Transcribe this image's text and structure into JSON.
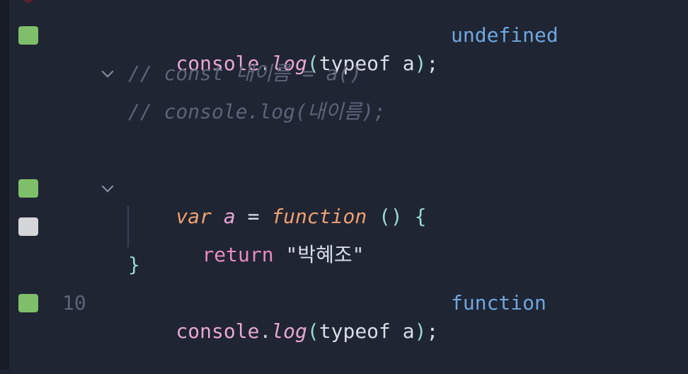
{
  "lines": [
    {
      "code": {
        "obj": "console",
        "dot": ".",
        "fn": "log",
        "open": "(",
        "arg": "typeof a",
        "close": ")",
        "semi": ";"
      },
      "result": "undefined"
    },
    {
      "comment": "// const 내이름 = a()"
    },
    {
      "comment": "// console.log(내이름);"
    },
    {
      "decl": {
        "var": "var",
        "name": "a",
        "eq": "=",
        "func": "function",
        "parens": "()",
        "brace": "{"
      }
    },
    {
      "ret": {
        "kw": "return",
        "str": "\"박혜조\""
      }
    },
    {
      "close": "}"
    },
    {
      "line_number": "10",
      "code": {
        "obj": "console",
        "dot": ".",
        "fn": "log",
        "open": "(",
        "arg": "typeof a",
        "close": ")",
        "semi": ";"
      },
      "result": "function"
    }
  ],
  "colors": {
    "background": "#1f2533",
    "marker_green": "#7fbf6a",
    "marker_gray": "#d4d6d9",
    "result": "#6ea7df"
  }
}
